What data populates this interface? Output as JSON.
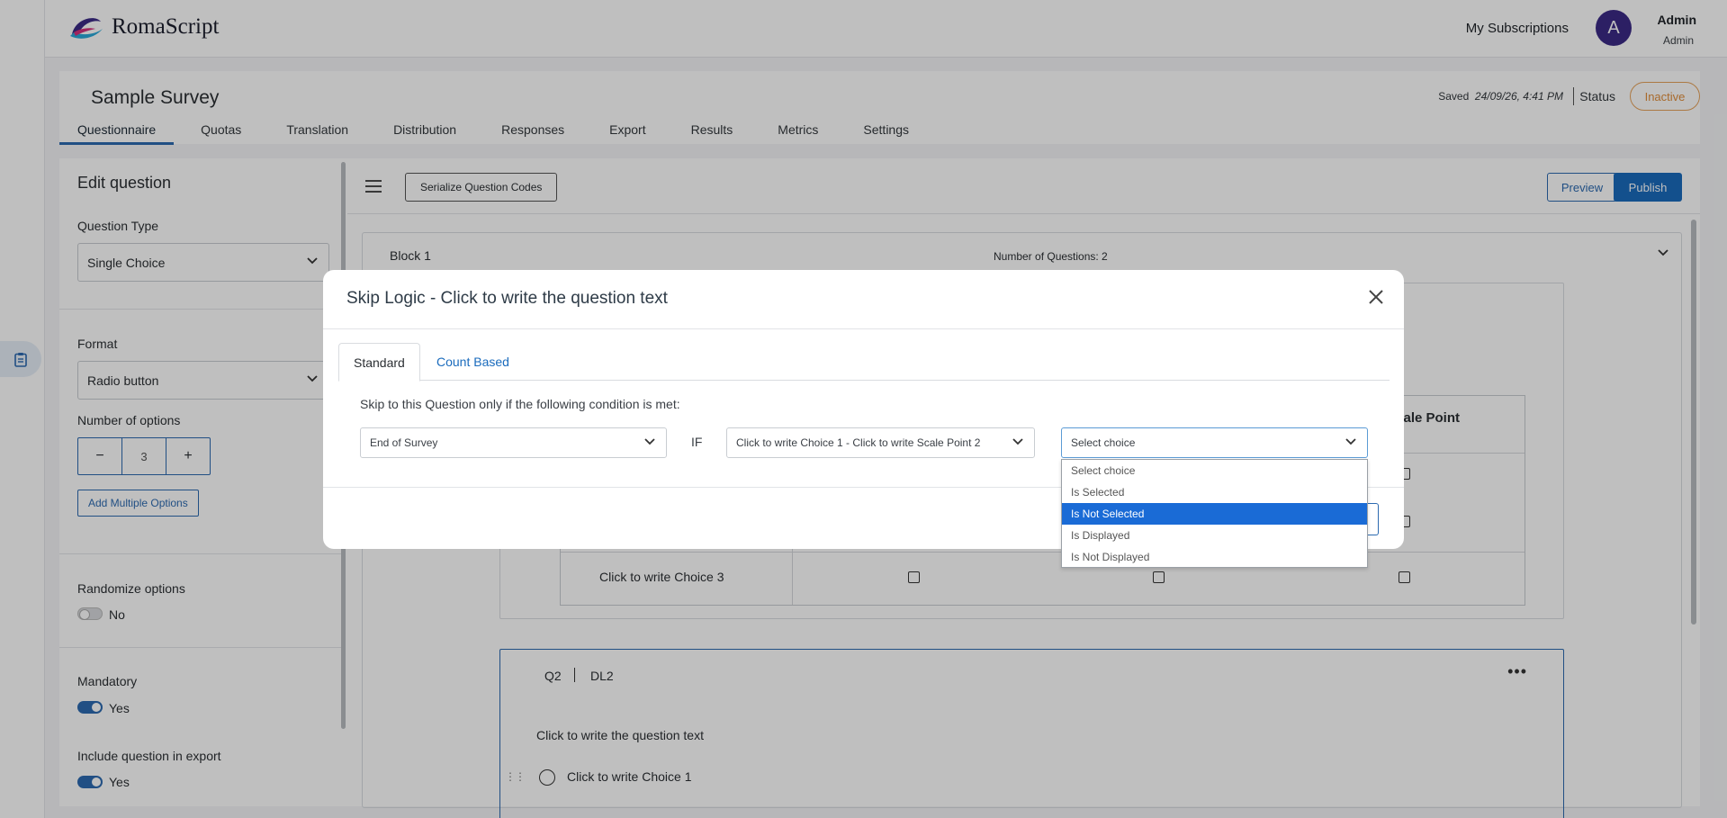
{
  "app": {
    "brand": "RomaScript",
    "nav": {
      "subscriptions": "My Subscriptions"
    },
    "user": {
      "initial": "A",
      "name": "Admin",
      "role": "Admin"
    }
  },
  "survey": {
    "title": "Sample Survey",
    "saved_label": "Saved",
    "saved_time": "24/09/26, 4:41 PM",
    "status_label": "Status",
    "status_value": "Inactive",
    "tabs": [
      {
        "label": "Questionnaire",
        "active": true
      },
      {
        "label": "Quotas"
      },
      {
        "label": "Translation"
      },
      {
        "label": "Distribution"
      },
      {
        "label": "Responses"
      },
      {
        "label": "Export"
      },
      {
        "label": "Results"
      },
      {
        "label": "Metrics"
      },
      {
        "label": "Settings"
      }
    ]
  },
  "editor": {
    "title": "Edit question",
    "question_type_label": "Question Type",
    "question_type_value": "Single Choice",
    "format_label": "Format",
    "format_value": "Radio button",
    "num_options_label": "Number of options",
    "num_options_value": "3",
    "minus": "−",
    "plus": "+",
    "add_multiple": "Add Multiple Options",
    "randomize_label": "Randomize options",
    "randomize_value": "No",
    "mandatory_label": "Mandatory",
    "mandatory_value": "Yes",
    "include_export_label": "Include question in export",
    "include_export_value": "Yes"
  },
  "canvas": {
    "serialize_btn": "Serialize Question Codes",
    "preview_btn": "Preview",
    "publish_btn": "Publish",
    "block_title": "Block 1",
    "block_count": "Number of Questions: 2",
    "q1_grid_header_partial": "ale Point",
    "q1_choice3": "Click to write Choice 3",
    "q2_code": "Q2",
    "q2_dl": "DL2",
    "q2_kebab": "•••",
    "q2_text": "Click to write the question text",
    "q2_choice1": "Click to write Choice 1"
  },
  "modal": {
    "title": "Skip Logic - Click to write the question text",
    "tabs": [
      {
        "label": "Standard",
        "active": true
      },
      {
        "label": "Count Based"
      }
    ],
    "condition_text": "Skip to this Question only if the following condition is met:",
    "target_select": "End of Survey",
    "if_label": "IF",
    "source_select": "Click to write Choice 1 - Click to write Scale Point 2",
    "choice_select": "Select choice",
    "dropdown_options": [
      {
        "label": "Select choice"
      },
      {
        "label": "Is Selected"
      },
      {
        "label": "Is Not Selected",
        "highlighted": true
      },
      {
        "label": "Is Displayed"
      },
      {
        "label": "Is Not Displayed"
      }
    ]
  },
  "colors": {
    "accent": "#1a6bbd",
    "status_inactive": "#e08e3c",
    "dropdown_highlight": "#1a6bd6",
    "avatar": "#3b2a86"
  }
}
